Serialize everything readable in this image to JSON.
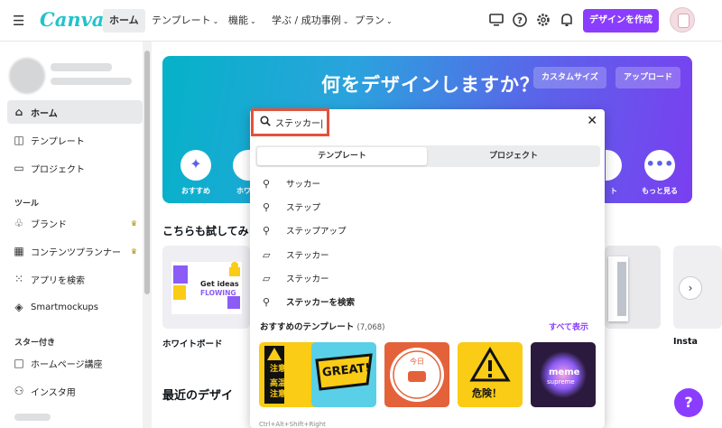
{
  "topbar": {
    "logo": "Canva",
    "nav": [
      "ホーム",
      "テンプレート",
      "機能",
      "学ぶ / 成功事例",
      "プラン"
    ],
    "create_button": "デザインを作成"
  },
  "sidebar": {
    "items": [
      {
        "icon": "home-icon",
        "label": "ホーム"
      },
      {
        "icon": "template-icon",
        "label": "テンプレート"
      },
      {
        "icon": "folder-icon",
        "label": "プロジェクト"
      }
    ],
    "tools_heading": "ツール",
    "tools": [
      {
        "icon": "brand-icon",
        "label": "ブランド"
      },
      {
        "icon": "calendar-icon",
        "label": "コンテンツプランナー"
      },
      {
        "icon": "apps-grid-icon",
        "label": "アプリを検索"
      },
      {
        "icon": "smartmockups-icon",
        "label": "Smartmockups"
      }
    ],
    "starred_heading": "スター付き",
    "starred": [
      {
        "icon": "page-icon",
        "label": "ホームページ講座"
      },
      {
        "icon": "people-icon",
        "label": "インスタ用"
      }
    ]
  },
  "hero": {
    "title": "何をデザインしますか？",
    "custom_size": "カスタムサイズ",
    "upload": "アップロード",
    "categories": [
      "おすすめ",
      "ホワ",
      "ト",
      "もっと見る"
    ]
  },
  "sections": {
    "try_title": "こちらも試してみ",
    "whiteboard_label": "ホワイトボード",
    "whiteboard_card_text": "Get ideas",
    "whiteboard_card_text2": "FLOWING",
    "insta_label": "Insta",
    "recent_title": "最近のデザイ"
  },
  "search_popup": {
    "query": "ステッカー",
    "tabs": [
      "テンプレート",
      "プロジェクト"
    ],
    "suggestions": [
      {
        "icon": "search-icon",
        "text": "サッカー",
        "bold": false
      },
      {
        "icon": "search-icon",
        "text": "ステップ",
        "bold": false
      },
      {
        "icon": "search-icon",
        "text": "ステップアップ",
        "bold": false
      },
      {
        "icon": "folder-icon",
        "text": "ステッカー",
        "bold": false
      },
      {
        "icon": "folder-icon",
        "text": "ステッカー",
        "bold": false
      },
      {
        "icon": "search-icon",
        "text": "ステッカーを検索",
        "bold": true
      }
    ],
    "recommended_title": "おすすめのテンプレート",
    "recommended_count": "(7,068)",
    "show_all": "すべて表示",
    "thumb_texts": [
      "注意",
      "高温",
      "注意",
      "GREAT!",
      "今日",
      "危険！",
      "meme",
      "supreme"
    ],
    "footer_hint": "Ctrl+Alt+Shift+Right"
  },
  "colors": {
    "accent": "#8b3dff",
    "highlight": "#e4523a",
    "brand": "#20c4cb"
  }
}
